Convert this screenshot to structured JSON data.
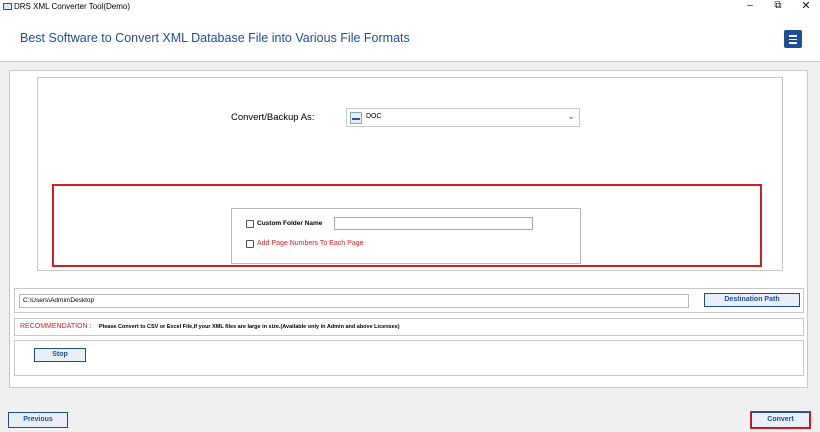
{
  "window": {
    "title": "DRS XML Converter Tool(Demo)",
    "minimize_glyph": "–",
    "maximize_glyph": "⧉",
    "close_glyph": "✕"
  },
  "header": {
    "headline": "Best Software to Convert XML Database File into Various File Formats",
    "menu_icon": "hamburger-menu-icon"
  },
  "convert": {
    "label": "Convert/Backup As:",
    "selected_format": "DOC",
    "format_icon": "doc-file-icon"
  },
  "options": {
    "custom_folder_label": "Custom Folder Name",
    "custom_folder_checked": false,
    "custom_folder_value": "",
    "page_numbers_label": "Add Page Numbers To Each Page",
    "page_numbers_checked": false
  },
  "destination": {
    "path": "C:\\Users\\Admin\\Desktop",
    "button_label": "Destination Path"
  },
  "recommendation": {
    "label": "RECOMMENDATION :",
    "text": "Please Convert to CSV or Excel File,If your XML files are large in size.(Available only in Admin and above Licenses)"
  },
  "actions": {
    "stop_label": "Stop",
    "previous_label": "Previous",
    "convert_label": "Convert"
  },
  "colors": {
    "accent": "#1f4e96",
    "highlight": "#d21f26"
  }
}
